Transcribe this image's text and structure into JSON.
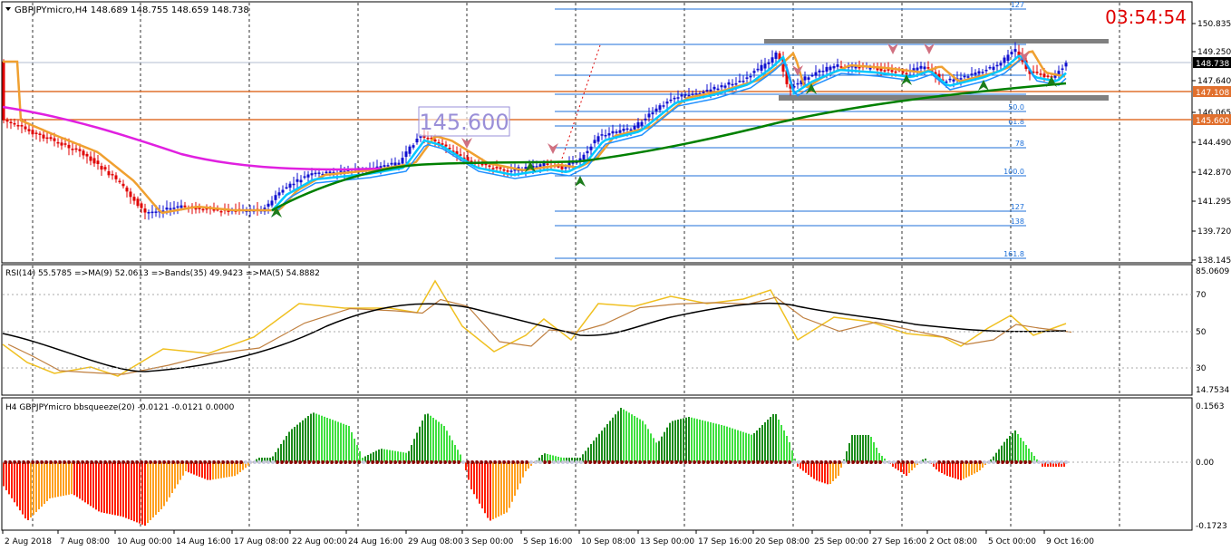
{
  "window": {
    "symbol_info": "GBPJPYmicro,H4  148.689 148.755 148.659 148.738",
    "countdown": "03:54:54",
    "big_label": "145.600"
  },
  "price_axis": {
    "ticks": [
      "150.835",
      "149.250",
      "147.640",
      "146.065",
      "144.490",
      "142.870",
      "141.295",
      "139.720",
      "138.145"
    ],
    "tags": [
      {
        "text": "148.738",
        "bg": "#000000",
        "fg": "#ffffff"
      },
      {
        "text": "147.108",
        "bg": "#e1702e",
        "fg": "#ffffff"
      },
      {
        "text": "145.600",
        "bg": "#e1702e",
        "fg": "#ffffff"
      }
    ]
  },
  "fib_levels": [
    "127",
    "",
    "",
    "",
    "50.0",
    "61.8",
    "78",
    "100.0",
    "127",
    "138",
    "161.8"
  ],
  "rsi": {
    "header": "RSI(14) 55.5785  =>MA(9) 52.0613  =>Bands(35) 49.9423  =>MA(5) 54.8882",
    "ticks": [
      "85.0609",
      "70",
      "50",
      "30",
      "14.7534"
    ]
  },
  "squeeze": {
    "header": "H4 GBPJPYmicro bbsqueeze(20) -0.0121 -0.0121 0.0000",
    "ticks": [
      "0.1563",
      "0.00",
      "-0.1723"
    ]
  },
  "time_axis": [
    "2 Aug 2018",
    "7 Aug 08:00",
    "10 Aug 00:00",
    "14 Aug 16:00",
    "17 Aug 08:00",
    "22 Aug 00:00",
    "24 Aug 16:00",
    "29 Aug 08:00",
    "3 Sep 00:00",
    "5 Sep 16:00",
    "10 Sep 08:00",
    "13 Sep 00:00",
    "17 Sep 16:00",
    "20 Sep 08:00",
    "25 Sep 00:00",
    "27 Sep 16:00",
    "2 Oct 08:00",
    "5 Oct 00:00",
    "9 Oct 16:00"
  ],
  "colors": {
    "bull_bar": "#1010d0",
    "bear_bar": "#e00000",
    "ma_fast": "#00c8ff",
    "ma_mid": "#f0a030",
    "ma_slow": "#008000",
    "ma_long": "#e020e0",
    "fib": "#1c6fd8",
    "rect": "#808080",
    "hline": "#e1702e",
    "rsi": "#f0c020",
    "rsi_ma": "#c08040",
    "rsi_band": "#000000",
    "sq_up_dark": "#1c8c1c",
    "sq_up_light": "#40e040",
    "sq_dn_red": "#ff2000",
    "sq_dn_org": "#ffa020",
    "dot": "#8b0000",
    "dot_grey": "#c8c8e0"
  }
}
